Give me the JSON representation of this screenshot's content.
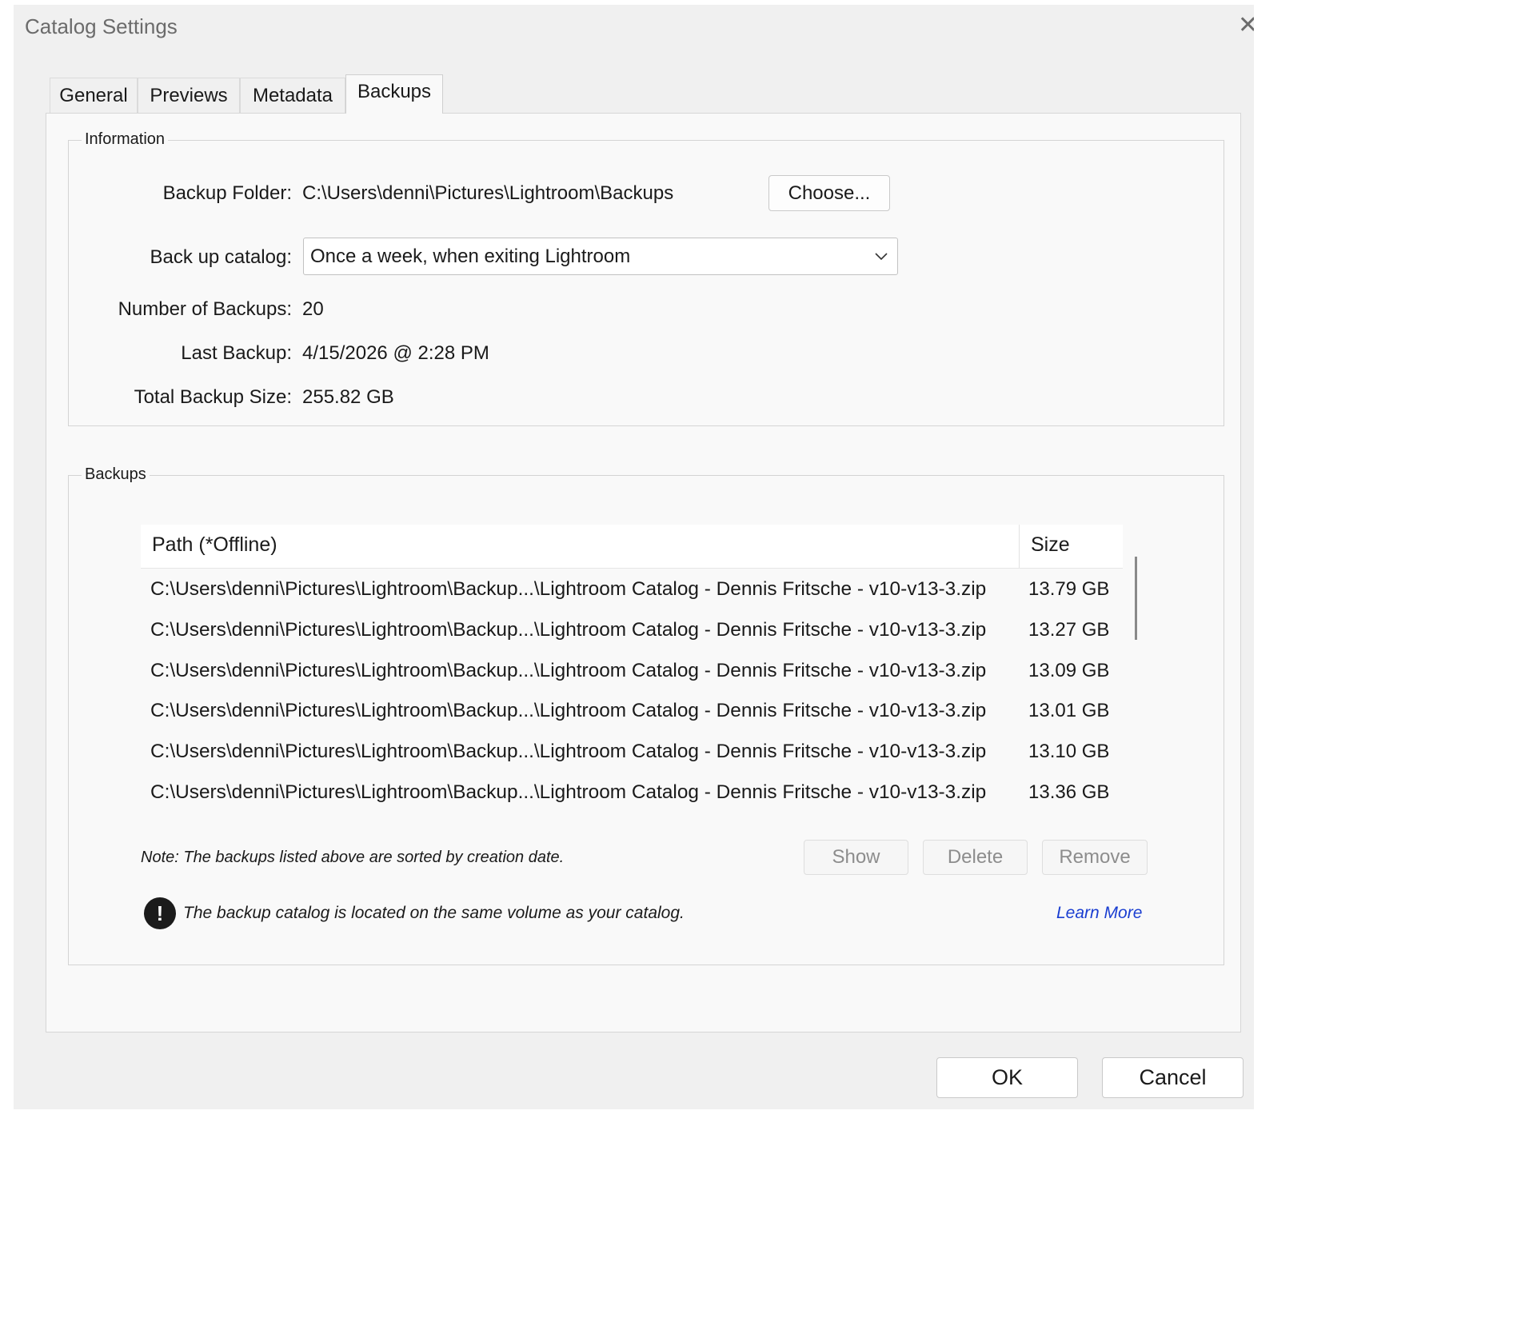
{
  "dialog": {
    "title": "Catalog Settings",
    "close_icon": "close-icon"
  },
  "tabs": [
    {
      "label": "General"
    },
    {
      "label": "Previews"
    },
    {
      "label": "Metadata"
    },
    {
      "label": "Backups",
      "active": true
    }
  ],
  "information": {
    "legend": "Information",
    "backup_folder_label": "Backup Folder:",
    "backup_folder_value": "C:\\Users\\denni\\Pictures\\Lightroom\\Backups",
    "choose_button": "Choose...",
    "backup_catalog_label": "Back up catalog:",
    "backup_catalog_value": "Once a week, when exiting Lightroom",
    "number_of_backups_label": "Number of Backups:",
    "number_of_backups_value": "20",
    "last_backup_label": "Last Backup:",
    "last_backup_value": "4/15/2026 @ 2:28 PM",
    "total_size_label": "Total Backup Size:",
    "total_size_value": "255.82 GB"
  },
  "backups": {
    "legend": "Backups",
    "columns": {
      "path": "Path (*Offline)",
      "size": "Size"
    },
    "rows": [
      {
        "path": "C:\\Users\\denni\\Pictures\\Lightroom\\Backup...\\Lightroom Catalog - Dennis Fritsche - v10-v13-3.zip",
        "size": "13.79 GB"
      },
      {
        "path": "C:\\Users\\denni\\Pictures\\Lightroom\\Backup...\\Lightroom Catalog - Dennis Fritsche - v10-v13-3.zip",
        "size": "13.27 GB"
      },
      {
        "path": "C:\\Users\\denni\\Pictures\\Lightroom\\Backup...\\Lightroom Catalog - Dennis Fritsche - v10-v13-3.zip",
        "size": "13.09 GB"
      },
      {
        "path": "C:\\Users\\denni\\Pictures\\Lightroom\\Backup...\\Lightroom Catalog - Dennis Fritsche - v10-v13-3.zip",
        "size": "13.01 GB"
      },
      {
        "path": "C:\\Users\\denni\\Pictures\\Lightroom\\Backup...\\Lightroom Catalog - Dennis Fritsche - v10-v13-3.zip",
        "size": "13.10 GB"
      },
      {
        "path": "C:\\Users\\denni\\Pictures\\Lightroom\\Backup...\\Lightroom Catalog - Dennis Fritsche - v10-v13-3.zip",
        "size": "13.36 GB"
      }
    ],
    "note": "Note: The backups listed above are sorted by creation date.",
    "show_button": "Show",
    "delete_button": "Delete",
    "remove_button": "Remove",
    "warning_text": "The backup catalog is located on the same volume as your catalog.",
    "warning_icon": "exclamation-icon",
    "learn_more": "Learn More"
  },
  "footer": {
    "ok_button": "OK",
    "cancel_button": "Cancel"
  },
  "colors": {
    "dialog_bg": "#f0f0f0",
    "panel_bg": "#f9f9f9",
    "link": "#1a3ed1",
    "disabled_text": "#8d8d8d"
  }
}
